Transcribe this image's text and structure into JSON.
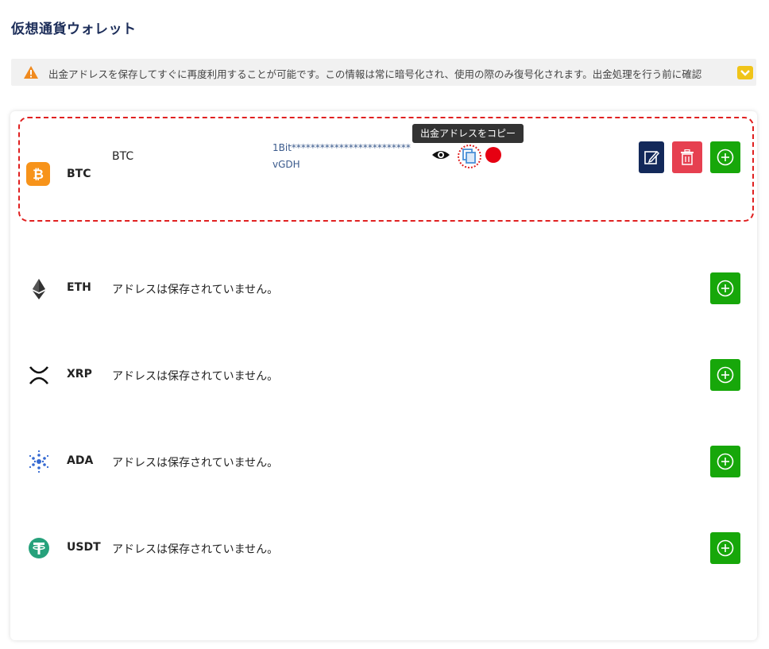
{
  "page": {
    "title": "仮想通貨ウォレット"
  },
  "notice": {
    "text": "出金アドレスを保存してすぐに再度利用することが可能です。この情報は常に暗号化され、使用の際のみ復号化されます。出金処理を行う前に確認",
    "icon": "warning-icon",
    "expand_icon": "chevron-down-icon"
  },
  "btc": {
    "code": "BTC",
    "label": "BTC",
    "address_line1": "1Bit*************************",
    "address_line2": "vGDH",
    "tooltip": "出金アドレスをコピー",
    "icon_color": "#f7931a"
  },
  "coins": [
    {
      "code": "ETH",
      "message": "アドレスは保存されていません。",
      "icon": "ethereum-icon"
    },
    {
      "code": "XRP",
      "message": "アドレスは保存されていません。",
      "icon": "xrp-icon"
    },
    {
      "code": "ADA",
      "message": "アドレスは保存されていません。",
      "icon": "cardano-icon"
    },
    {
      "code": "USDT",
      "message": "アドレスは保存されていません。",
      "icon": "tether-icon"
    }
  ],
  "colors": {
    "add": "#17a70a",
    "edit": "#13295a",
    "delete": "#e64050",
    "highlight": "#e02020",
    "title": "#1d2e5a"
  }
}
